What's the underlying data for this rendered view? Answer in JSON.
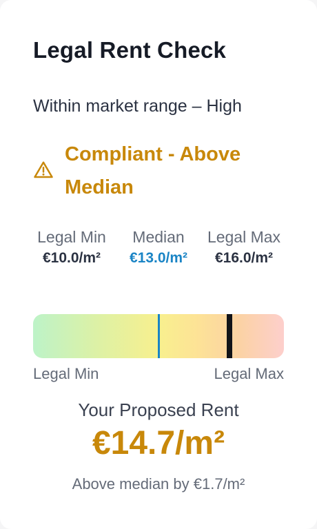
{
  "card": {
    "title": "Legal Rent Check",
    "subtitle": "Within market range – High",
    "status": {
      "icon": "warning-triangle-icon",
      "text": "Compliant - Above Median",
      "color": "#c8880a"
    },
    "range": {
      "min": {
        "label": "Legal Min",
        "value": "€10.0/m²"
      },
      "median": {
        "label": "Median",
        "value": "€13.0/m²",
        "color": "#1a84c5"
      },
      "max": {
        "label": "Legal Max",
        "value": "€16.0/m²"
      }
    },
    "gauge": {
      "min_value": 10.0,
      "max_value": 16.0,
      "median_value": 13.0,
      "proposed_value": 14.7,
      "label_left": "Legal Min",
      "label_right": "Legal Max"
    },
    "proposed": {
      "label": "Your Proposed Rent",
      "value": "€14.7/m²",
      "note": "Above median by €1.7/m²"
    }
  }
}
